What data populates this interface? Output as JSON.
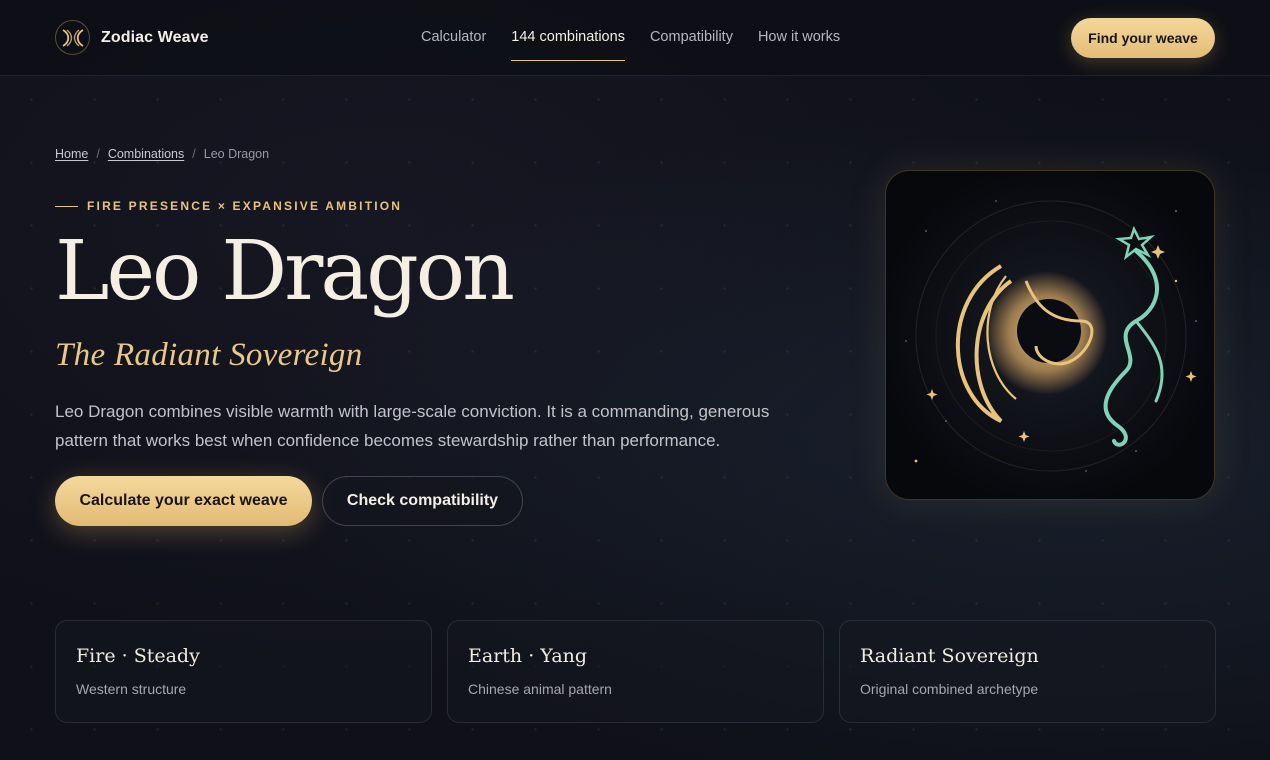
{
  "header": {
    "brand": "Zodiac Weave",
    "nav": [
      "Calculator",
      "144 combinations",
      "Compatibility",
      "How it works"
    ],
    "active_nav": "144 combinations",
    "cta": "Find your weave"
  },
  "breadcrumb": {
    "home": "Home",
    "combinations": "Combinations",
    "current": "Leo Dragon"
  },
  "hero": {
    "eyebrow": "FIRE PRESENCE × EXPANSIVE AMBITION",
    "title": "Leo Dragon",
    "subtitle": "The Radiant Sovereign",
    "description": "Leo Dragon combines visible warmth with large-scale conviction. It is a commanding, generous pattern that works best when confidence becomes stewardship rather than performance.",
    "primary_button": "Calculate your exact weave",
    "secondary_button": "Check compatibility"
  },
  "cards": [
    {
      "title": "Fire · Steady",
      "caption": "Western structure"
    },
    {
      "title": "Earth · Yang",
      "caption": "Chinese animal pattern"
    },
    {
      "title": "Radiant Sovereign",
      "caption": "Original combined archetype"
    }
  ],
  "colors": {
    "accent_gold": "#e8c37a",
    "dragon_teal": "#7fd3b6",
    "background": "#0f1018"
  }
}
